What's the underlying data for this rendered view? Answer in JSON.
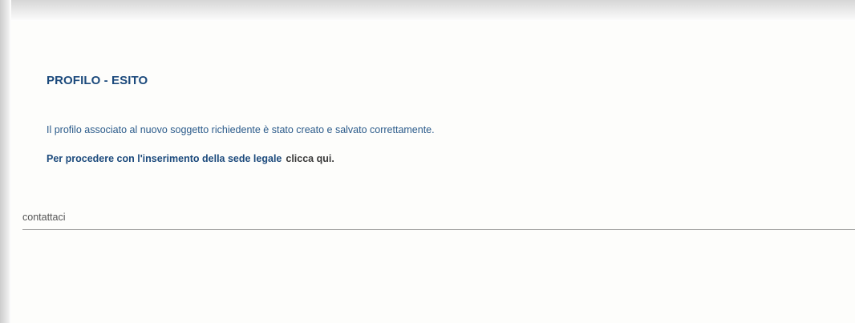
{
  "profile_result": {
    "title": "PROFILO - ESITO",
    "message": "Il profilo associato al nuovo soggetto richiedente è stato creato e salvato correttamente.",
    "proceed_text": "Per procedere con l'inserimento della sede legale",
    "proceed_link": "clicca qui."
  },
  "footer": {
    "contact_link": "contattaci"
  },
  "colors": {
    "title": "#1c4a7c",
    "message": "#2a5a8a",
    "link": "#3a3a3a",
    "footer_text": "#555555",
    "divider": "#9a9a9a",
    "background": "#fdfdfb"
  }
}
